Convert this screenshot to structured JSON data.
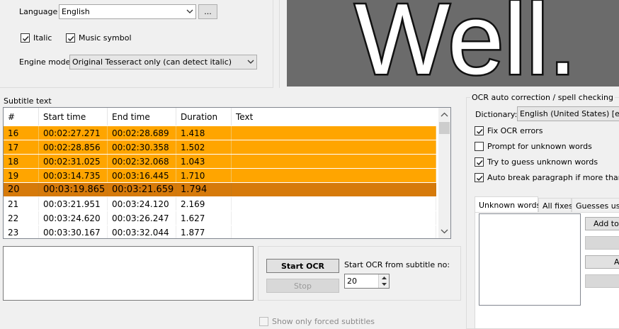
{
  "ocr_settings": {
    "language_label": "Language",
    "language_value": "English",
    "browse_label": "...",
    "italic_label": "Italic",
    "italic_checked": true,
    "music_label": "Music symbol",
    "music_checked": true,
    "engine_label": "Engine mode",
    "engine_value": "Original Tesseract only (can detect italic)"
  },
  "preview": {
    "text": "Well."
  },
  "subtitle": {
    "section_label": "Subtitle text",
    "columns": [
      "#",
      "Start time",
      "End time",
      "Duration",
      "Text"
    ],
    "rows": [
      {
        "num": "16",
        "start": "00:02:27.271",
        "end": "00:02:28.689",
        "duration": "1.418",
        "text": "",
        "state": "orange"
      },
      {
        "num": "17",
        "start": "00:02:28.856",
        "end": "00:02:30.358",
        "duration": "1.502",
        "text": "",
        "state": "orange"
      },
      {
        "num": "18",
        "start": "00:02:31.025",
        "end": "00:02:32.068",
        "duration": "1.043",
        "text": "",
        "state": "orange"
      },
      {
        "num": "19",
        "start": "00:03:14.735",
        "end": "00:03:16.445",
        "duration": "1.710",
        "text": "",
        "state": "orange"
      },
      {
        "num": "20",
        "start": "00:03:19.865",
        "end": "00:03:21.659",
        "duration": "1.794",
        "text": "",
        "state": "selected"
      },
      {
        "num": "21",
        "start": "00:03:21.951",
        "end": "00:03:24.120",
        "duration": "2.169",
        "text": "",
        "state": "normal"
      },
      {
        "num": "22",
        "start": "00:03:24.620",
        "end": "00:03:26.247",
        "duration": "1.627",
        "text": "",
        "state": "normal"
      },
      {
        "num": "23",
        "start": "00:03:30.167",
        "end": "00:03:32.044",
        "duration": "1.877",
        "text": "",
        "state": "normal"
      }
    ]
  },
  "ocr_controls": {
    "start_button": "Start OCR",
    "stop_button": "Stop",
    "start_from_label": "Start OCR from subtitle no:",
    "start_from_value": "20",
    "forced_label": "Show only forced subtitles"
  },
  "autocorrect": {
    "section_label": "OCR auto correction / spell checking",
    "dictionary_label": "Dictionary:",
    "dictionary_value": "English (United States) [en_U",
    "options": [
      {
        "label": "Fix OCR errors",
        "checked": true
      },
      {
        "label": "Prompt for unknown words",
        "checked": false
      },
      {
        "label": "Try to guess unknown words",
        "checked": true
      },
      {
        "label": "Auto break paragraph if more than two",
        "checked": true
      }
    ],
    "tabs": [
      "Unknown words",
      "All fixes",
      "Guesses use"
    ],
    "add_button": "Add to n",
    "a_button": "A"
  },
  "colors": {
    "orange_row": "#ffa500",
    "selected_row": "#d67a0a",
    "preview_bg": "#6b6b6b"
  },
  "icons": [
    "chevron-down-icon",
    "checkmark-icon",
    "spin-up-icon",
    "spin-down-icon",
    "scroll-up-icon",
    "scroll-down-icon"
  ]
}
